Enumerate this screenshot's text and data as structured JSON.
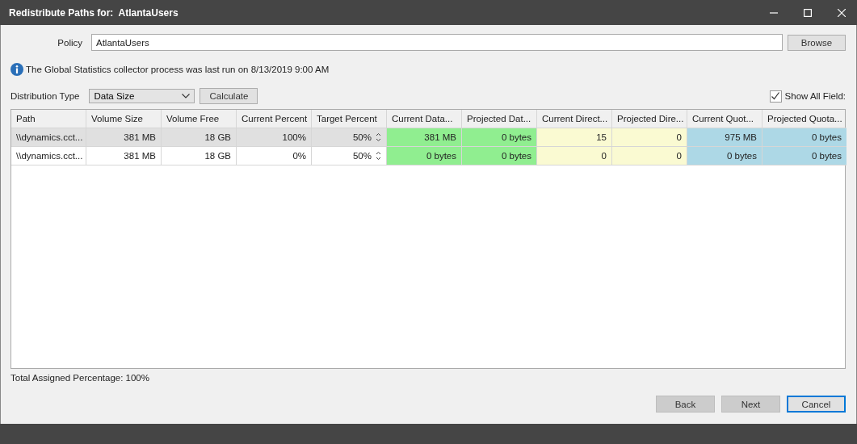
{
  "window": {
    "title": "Redistribute Paths for:  AtlantaUsers"
  },
  "policy": {
    "label": "Policy",
    "value": "AtlantaUsers",
    "browse": "Browse"
  },
  "info": "The Global Statistics collector process was last run on 8/13/2019 9:00 AM",
  "distribution": {
    "label": "Distribution Type",
    "value": "Data Size",
    "calculate": "Calculate"
  },
  "show_all_fields": {
    "label": "Show All Field:",
    "checked": true
  },
  "table": {
    "columns": [
      {
        "label": "Path",
        "kind": "text"
      },
      {
        "label": "Volume Size",
        "kind": "number"
      },
      {
        "label": "Volume Free",
        "kind": "number"
      },
      {
        "label": "Current Percent",
        "kind": "number"
      },
      {
        "label": "Target Percent",
        "kind": "spinner"
      },
      {
        "label": "Current Data...",
        "kind": "number",
        "color": "#90ee90"
      },
      {
        "label": "Projected Dat...",
        "kind": "number",
        "color": "#90ee90"
      },
      {
        "label": "Current Direct...",
        "kind": "number",
        "color": "#fafad2"
      },
      {
        "label": "Projected Dire...",
        "kind": "number",
        "color": "#fafad2"
      },
      {
        "label": "Current Quot...",
        "kind": "number",
        "color": "#add8e6"
      },
      {
        "label": "Projected Quota...",
        "kind": "number",
        "color": "#add8e6"
      }
    ],
    "rows": [
      {
        "selected": true,
        "cells": [
          "\\\\dynamics.cct...",
          "381 MB",
          "18 GB",
          "100%",
          "50%",
          "381 MB",
          "0 bytes",
          "15",
          "0",
          "975 MB",
          "0 bytes"
        ]
      },
      {
        "selected": false,
        "cells": [
          "\\\\dynamics.cct...",
          "381 MB",
          "18 GB",
          "0%",
          "50%",
          "0 bytes",
          "0 bytes",
          "0",
          "0",
          "0 bytes",
          "0 bytes"
        ]
      }
    ]
  },
  "total": "Total Assigned Percentage: 100%",
  "buttons": [
    {
      "label": "Back",
      "focused": false
    },
    {
      "label": "Next",
      "focused": false
    },
    {
      "label": "Cancel",
      "focused": true
    }
  ]
}
